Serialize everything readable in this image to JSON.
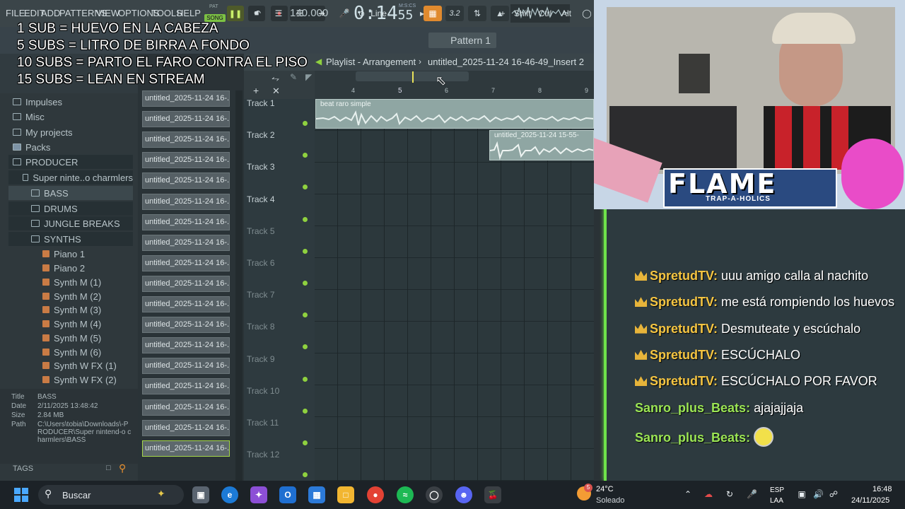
{
  "menu": [
    "FILE",
    "EDIT",
    "ADD",
    "PATTERNS",
    "VIEW",
    "OPTIONS",
    "TOOLS",
    "HELP"
  ],
  "transport": {
    "pat_label": "PAT",
    "song_label": "SONG",
    "tempo": "140.000",
    "clock_main": "0:14",
    "clock_sub": "55",
    "clock_units": "M:S:CS",
    "pitch": "3.2"
  },
  "toolbar2": {
    "snap": "Line",
    "pattern": "Pattern 1",
    "shift": "Shift",
    "ctrl": "Ctrl",
    "alt": "Alt"
  },
  "overlay": {
    "line1": "1 SUB = HUEVO EN LA CABEZA",
    "line2": "5 SUBS = LITRO DE BIRRA A FONDO",
    "line3": "10 SUBS = PARTO EL FARO CONTRA EL PISO",
    "line4": "15 SUBS = LEAN EN STREAM"
  },
  "browser": {
    "items": [
      "Impulses",
      "Misc",
      "My projects",
      "Packs",
      "PRODUCER",
      "Super ninte..o charmlers",
      "BASS",
      "DRUMS",
      "JUNGLE BREAKS",
      "SYNTHS"
    ],
    "synths": [
      "Piano 1",
      "Piano 2",
      "Synth M (1)",
      "Synth M (2)",
      "Synth M (3)",
      "Synth M (4)",
      "Synth M (5)",
      "Synth M (6)",
      "Synth W FX (1)",
      "Synth W FX (2)"
    ],
    "info": {
      "title_k": "Title",
      "title_v": "BASS",
      "date_k": "Date",
      "date_v": "2/11/2025 13:48:42",
      "size_k": "Size",
      "size_v": "2.84 MB",
      "path_k": "Path",
      "path_v": "C:\\Users\\tobia\\Downloads\\-PRODUCER\\Super nintend-o charmlers\\BASS"
    },
    "tags": "TAGS"
  },
  "clips": [
    "untitled_2025-11-24 16-...",
    "untitled_2025-11-24 16-...",
    "untitled_2025-11-24 16-...",
    "untitled_2025-11-24 16-...",
    "untitled_2025-11-24 16-...",
    "untitled_2025-11-24 16-...",
    "untitled_2025-11-24 16-...",
    "untitled_2025-11-24 16-...",
    "untitled_2025-11-24 16-...",
    "untitled_2025-11-24 16-...",
    "untitled_2025-11-24 16-...",
    "untitled_2025-11-24 16-...",
    "untitled_2025-11-24 16-...",
    "untitled_2025-11-24 16-...",
    "untitled_2025-11-24 16-...",
    "untitled_2025-11-24 16-...",
    "untitled_2025-11-24 16-...",
    "untitled_2025-11-24 16-..."
  ],
  "playlist": {
    "title": "Playlist - Arrangement",
    "file": "untitled_2025-11-24 16-46-49_Insert 2",
    "ruler": [
      "4",
      "5",
      "6",
      "7",
      "8",
      "9"
    ],
    "tracks": [
      "Track 1",
      "Track 2",
      "Track 3",
      "Track 4",
      "Track 5",
      "Track 6",
      "Track 7",
      "Track 8",
      "Track 9",
      "Track 10",
      "Track 11",
      "Track 12"
    ],
    "clip1": "beat raro simple",
    "clip2": "untitled_2025-11-24 15-55-"
  },
  "cam": {
    "flame": "FLAME",
    "trap": "TRAP-A-HOLICS"
  },
  "chat": [
    {
      "user": "SpretudTV",
      "msg": "uuu amigo calla al nachito",
      "crown": true
    },
    {
      "user": "SpretudTV",
      "msg": "me está rompiendo los huevos",
      "crown": true
    },
    {
      "user": "SpretudTV",
      "msg": "Desmuteate y escúchalo",
      "crown": true
    },
    {
      "user": "SpretudTV",
      "msg": "ESCÚCHALO",
      "crown": true
    },
    {
      "user": "SpretudTV",
      "msg": "ESCÚCHALO POR FAVOR",
      "crown": true
    },
    {
      "user": "Sanro_plus_Beats",
      "msg": "ajajajjaja",
      "crown": false
    },
    {
      "user": "Sanro_plus_Beats",
      "msg": "",
      "crown": false
    }
  ],
  "taskbar": {
    "search": "Buscar",
    "temp": "24°C",
    "weather": "Soleado",
    "weather_badge": "5",
    "lang1": "ESP",
    "lang2": "LAA",
    "time": "16:48",
    "date": "24/11/2025"
  },
  "colors": {
    "accent_green": "#8fd13f",
    "chat_user": "#f5c542",
    "chat_user_green": "#9be554",
    "playhead": "#6fe34a"
  }
}
